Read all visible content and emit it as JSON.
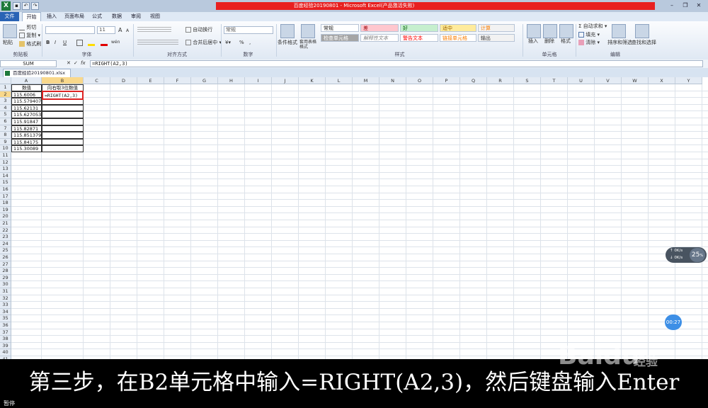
{
  "window": {
    "title": "百度经验20190801 - Microsoft Excel(产品激活失败)",
    "xl_icon": "X",
    "controls": [
      "–",
      "❐",
      "✕"
    ]
  },
  "ribbon_tabs": [
    "文件",
    "开始",
    "插入",
    "页面布局",
    "公式",
    "数据",
    "审阅",
    "视图"
  ],
  "ribbon": {
    "clipboard": {
      "cut": "剪切",
      "copy": "复制 ▾",
      "format_painter": "格式刷",
      "paste": "粘贴",
      "label": "剪贴板"
    },
    "font": {
      "size": "11",
      "bold": "B",
      "italic": "I",
      "underline": "U",
      "grow": "A",
      "shrink": "A",
      "wen": "wén",
      "label": "字体"
    },
    "alignment": {
      "wrap": "自动换行",
      "merge": "合并后居中 ▾",
      "label": "对齐方式"
    },
    "number": {
      "format": "常规",
      "percent": "%",
      "comma": ",",
      "label": "数字"
    },
    "styles": {
      "cond_format": "条件格式",
      "table_format": "套用表格格式",
      "cells": [
        {
          "text": "常规",
          "bg": "#ffffff",
          "fg": "#222222"
        },
        {
          "text": "差",
          "bg": "#ffc7ce",
          "fg": "#9c0006"
        },
        {
          "text": "好",
          "bg": "#c6efce",
          "fg": "#006100"
        },
        {
          "text": "适中",
          "bg": "#ffeb9c",
          "fg": "#9c6500"
        },
        {
          "text": "计算",
          "bg": "#f2f2f2",
          "fg": "#fa7d00"
        },
        {
          "text": "检查单元格",
          "bg": "#a5a5a5",
          "fg": "#ffffff"
        },
        {
          "text": "解释性文本",
          "bg": "#ffffff",
          "fg": "#7f7f7f"
        },
        {
          "text": "警告文本",
          "bg": "#ffffff",
          "fg": "#ff0000"
        },
        {
          "text": "链接单元格",
          "bg": "#ffffff",
          "fg": "#fa7d00"
        },
        {
          "text": "输出",
          "bg": "#f2f2f2",
          "fg": "#3f3f3f"
        }
      ],
      "label": "样式"
    },
    "cells_group": {
      "insert": "插入",
      "delete": "删除",
      "format": "格式",
      "label": "单元格"
    },
    "editing": {
      "autosum": "Σ 自动求和 ▾",
      "fill": "填充 ▾",
      "clear": "清除 ▾",
      "sort": "排序和筛选",
      "find": "查找和选择",
      "label": "编辑"
    }
  },
  "formula_bar": {
    "name_box": "SUM",
    "fx": "fx",
    "content": "=RIGHT(A2,3)"
  },
  "workbook_tab": "百度经验20190801.xlsx",
  "sheet": {
    "columns": [
      "A",
      "B",
      "C",
      "D",
      "E",
      "F",
      "G",
      "H",
      "I",
      "J",
      "K",
      "L",
      "M",
      "N",
      "O",
      "P",
      "Q",
      "R",
      "S",
      "T",
      "U",
      "V",
      "W",
      "X",
      "Y"
    ],
    "rows": 41,
    "header_a": "数值",
    "header_b": "向右取3位数值",
    "values_a": [
      "115.6006",
      "115.579407",
      "115.62131",
      "115.627053",
      "115.91847",
      "115.82871",
      "115.851379",
      "115.84175",
      "115.30089"
    ],
    "b2_formula": "=RIGHT(A2,3)"
  },
  "overlays": {
    "speed_percent": "25",
    "speed_unit": "%",
    "up": "0K/s",
    "down": "0K/s",
    "timer": "00:27"
  },
  "caption": "第三步，在B2单元格中输入=RIGHT(A2,3)，然后键盘输入Enter",
  "status": "暂停",
  "watermark": {
    "brand": "Baidu",
    "cn": "经验"
  }
}
